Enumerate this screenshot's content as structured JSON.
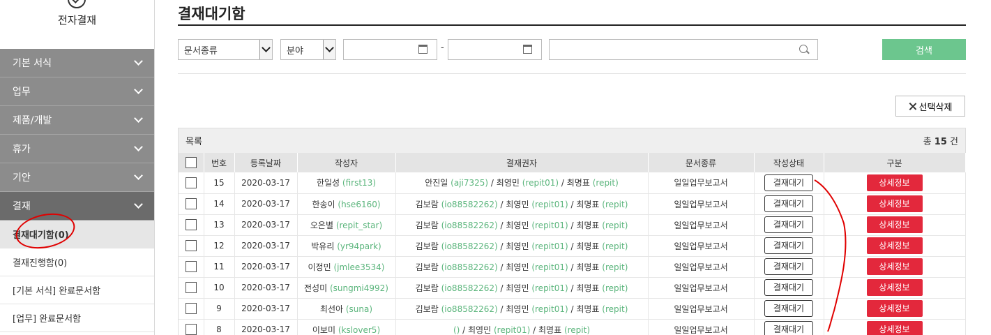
{
  "sidebar": {
    "title": "전자결재",
    "menu": [
      {
        "label": "기본 서식"
      },
      {
        "label": "업무"
      },
      {
        "label": "제품/개발"
      },
      {
        "label": "휴가"
      },
      {
        "label": "기안"
      },
      {
        "label": "결재"
      }
    ],
    "sub_items": [
      {
        "label": "결재대기함(0)"
      },
      {
        "label": "결재진행함(0)"
      },
      {
        "label": "[기본 서식] 완료문서함"
      },
      {
        "label": "[업무] 완료문서함"
      }
    ]
  },
  "main": {
    "title": "결재대기함",
    "filters": {
      "doc_type": "문서종류",
      "field": "분야",
      "date_sep": "-",
      "search_label": "검색"
    },
    "delete_label": "선택삭제",
    "list_label": "목록",
    "total_prefix": "총",
    "total_count": "15",
    "total_suffix": "건",
    "columns": [
      "번호",
      "등록날짜",
      "작성자",
      "결재권자",
      "문서종류",
      "작성상태",
      "구분"
    ],
    "rows": [
      {
        "no": "15",
        "date": "2020-03-17",
        "author": "한일성",
        "author_id": "(first13)",
        "approvers": [
          [
            "안진일",
            "(aji7325)"
          ],
          [
            "최영민",
            "(repit01)"
          ],
          [
            "최명표",
            "(repit)"
          ]
        ],
        "doc_type": "일일업무보고서",
        "status": "결재대기",
        "detail": "상세정보"
      },
      {
        "no": "14",
        "date": "2020-03-17",
        "author": "한송이",
        "author_id": "(hse6160)",
        "approvers": [
          [
            "김보람",
            "(io88582262)"
          ],
          [
            "최영민",
            "(repit01)"
          ],
          [
            "최명표",
            "(repit)"
          ]
        ],
        "doc_type": "일일업무보고서",
        "status": "결재대기",
        "detail": "상세정보"
      },
      {
        "no": "13",
        "date": "2020-03-17",
        "author": "오은별",
        "author_id": "(repit_star)",
        "approvers": [
          [
            "김보람",
            "(io88582262)"
          ],
          [
            "최영민",
            "(repit01)"
          ],
          [
            "최명표",
            "(repit)"
          ]
        ],
        "doc_type": "일일업무보고서",
        "status": "결재대기",
        "detail": "상세정보"
      },
      {
        "no": "12",
        "date": "2020-03-17",
        "author": "박유리",
        "author_id": "(yr94park)",
        "approvers": [
          [
            "김보람",
            "(io88582262)"
          ],
          [
            "최영민",
            "(repit01)"
          ],
          [
            "최명표",
            "(repit)"
          ]
        ],
        "doc_type": "일일업무보고서",
        "status": "결재대기",
        "detail": "상세정보"
      },
      {
        "no": "11",
        "date": "2020-03-17",
        "author": "이정민",
        "author_id": "(jmlee3534)",
        "approvers": [
          [
            "김보람",
            "(io88582262)"
          ],
          [
            "최영민",
            "(repit01)"
          ],
          [
            "최명표",
            "(repit)"
          ]
        ],
        "doc_type": "일일업무보고서",
        "status": "결재대기",
        "detail": "상세정보"
      },
      {
        "no": "10",
        "date": "2020-03-17",
        "author": "전성미",
        "author_id": "(sungmi4992)",
        "approvers": [
          [
            "김보람",
            "(io88582262)"
          ],
          [
            "최영민",
            "(repit01)"
          ],
          [
            "최명표",
            "(repit)"
          ]
        ],
        "doc_type": "일일업무보고서",
        "status": "결재대기",
        "detail": "상세정보"
      },
      {
        "no": "9",
        "date": "2020-03-17",
        "author": "최선아",
        "author_id": "(suna)",
        "approvers": [
          [
            "김보람",
            "(io88582262)"
          ],
          [
            "최영민",
            "(repit01)"
          ],
          [
            "최명표",
            "(repit)"
          ]
        ],
        "doc_type": "일일업무보고서",
        "status": "결재대기",
        "detail": "상세정보"
      },
      {
        "no": "8",
        "date": "2020-03-17",
        "author": "이보미",
        "author_id": "(kslover5)",
        "approvers": [
          [
            "",
            "()"
          ],
          [
            "최영민",
            "(repit01)"
          ],
          [
            "최명표",
            "(repit)"
          ]
        ],
        "doc_type": "일일업무보고서",
        "status": "결재대기",
        "detail": "상세정보"
      }
    ]
  },
  "colors": {
    "accent_green": "#6cc68e",
    "id_green": "#5bb57c",
    "detail_red": "#e3283c",
    "annotation_red": "#e00000"
  }
}
